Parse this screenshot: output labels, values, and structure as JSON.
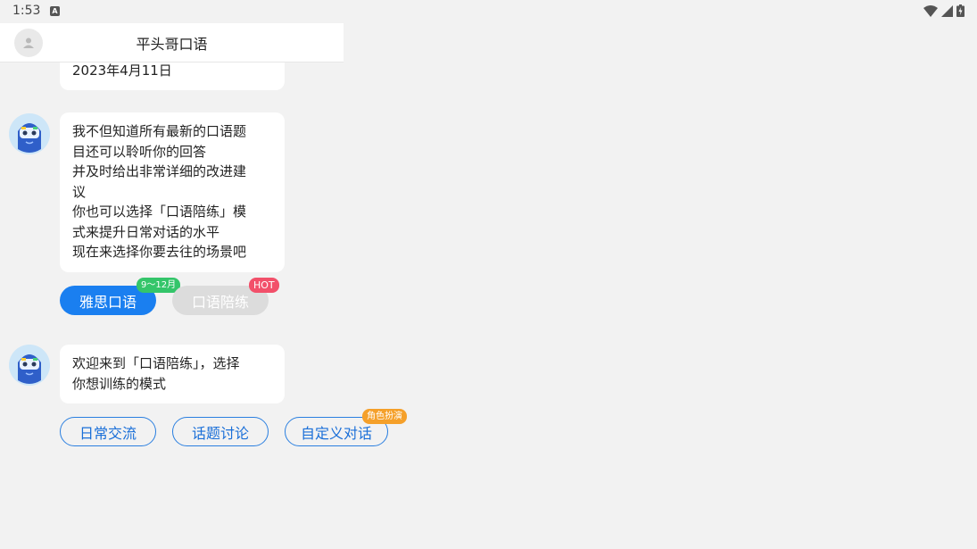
{
  "status_bar": {
    "time": "1:53",
    "notification_icon": "A"
  },
  "header": {
    "title": "平头哥口语"
  },
  "messages": {
    "date_bubble": {
      "text": "2023年4月11日"
    },
    "intro": {
      "lines": [
        "我不但知道所有最新的口语题",
        "目还可以聆听你的回答",
        "并及时给出非常详细的改进建",
        "议",
        "你也可以选择「口语陪练」模",
        "式来提升日常对话的水平",
        "现在来选择你要去往的场景吧"
      ]
    },
    "modes": {
      "ielts": {
        "label": "雅思口语",
        "badge": "9～12月"
      },
      "practice": {
        "label": "口语陪练",
        "badge": "HOT"
      }
    },
    "welcome": {
      "lines": [
        "欢迎来到「口语陪练」，选择",
        "你想训练的模式"
      ]
    },
    "training": {
      "daily": {
        "label": "日常交流"
      },
      "topic": {
        "label": "话题讨论"
      },
      "custom": {
        "label": "自定义对话",
        "badge": "角色扮演"
      }
    }
  },
  "colors": {
    "primary": "#1a7ff0",
    "hot_badge": "#f2506a",
    "month_badge": "#34c56a",
    "role_badge": "#f5a02a"
  }
}
